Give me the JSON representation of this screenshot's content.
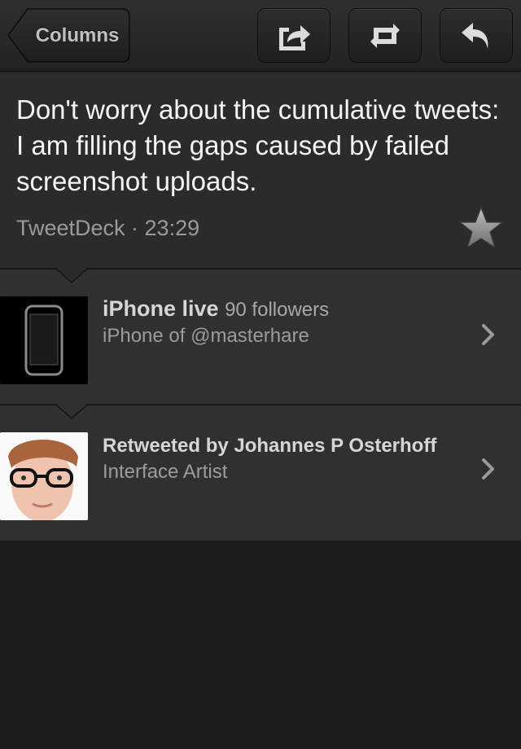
{
  "navbar": {
    "back_label": "Columns",
    "share_icon": "share-icon",
    "retweet_icon": "retweet-icon",
    "reply_icon": "reply-icon"
  },
  "tweet": {
    "text": "Don't worry about the cumulative tweets: I am filling the gaps caused by failed screenshot uploads.",
    "meta": "TweetDeck · 23:29",
    "favorite_icon": "star-icon"
  },
  "rows": [
    {
      "name": "iPhone live",
      "followers": "90 followers",
      "subtitle": "iPhone of @masterhare",
      "avatar_icon": "iphone-avatar"
    },
    {
      "name": "Retweeted by Johannes P Osterhoff",
      "subtitle": "Interface Artist",
      "avatar_icon": "user-avatar"
    }
  ],
  "colors": {
    "background": "#1b1b1b",
    "panel": "#2b2b2b",
    "row": "#303030",
    "text_primary": "#f4f4f4",
    "text_secondary": "#9c9c9c"
  }
}
